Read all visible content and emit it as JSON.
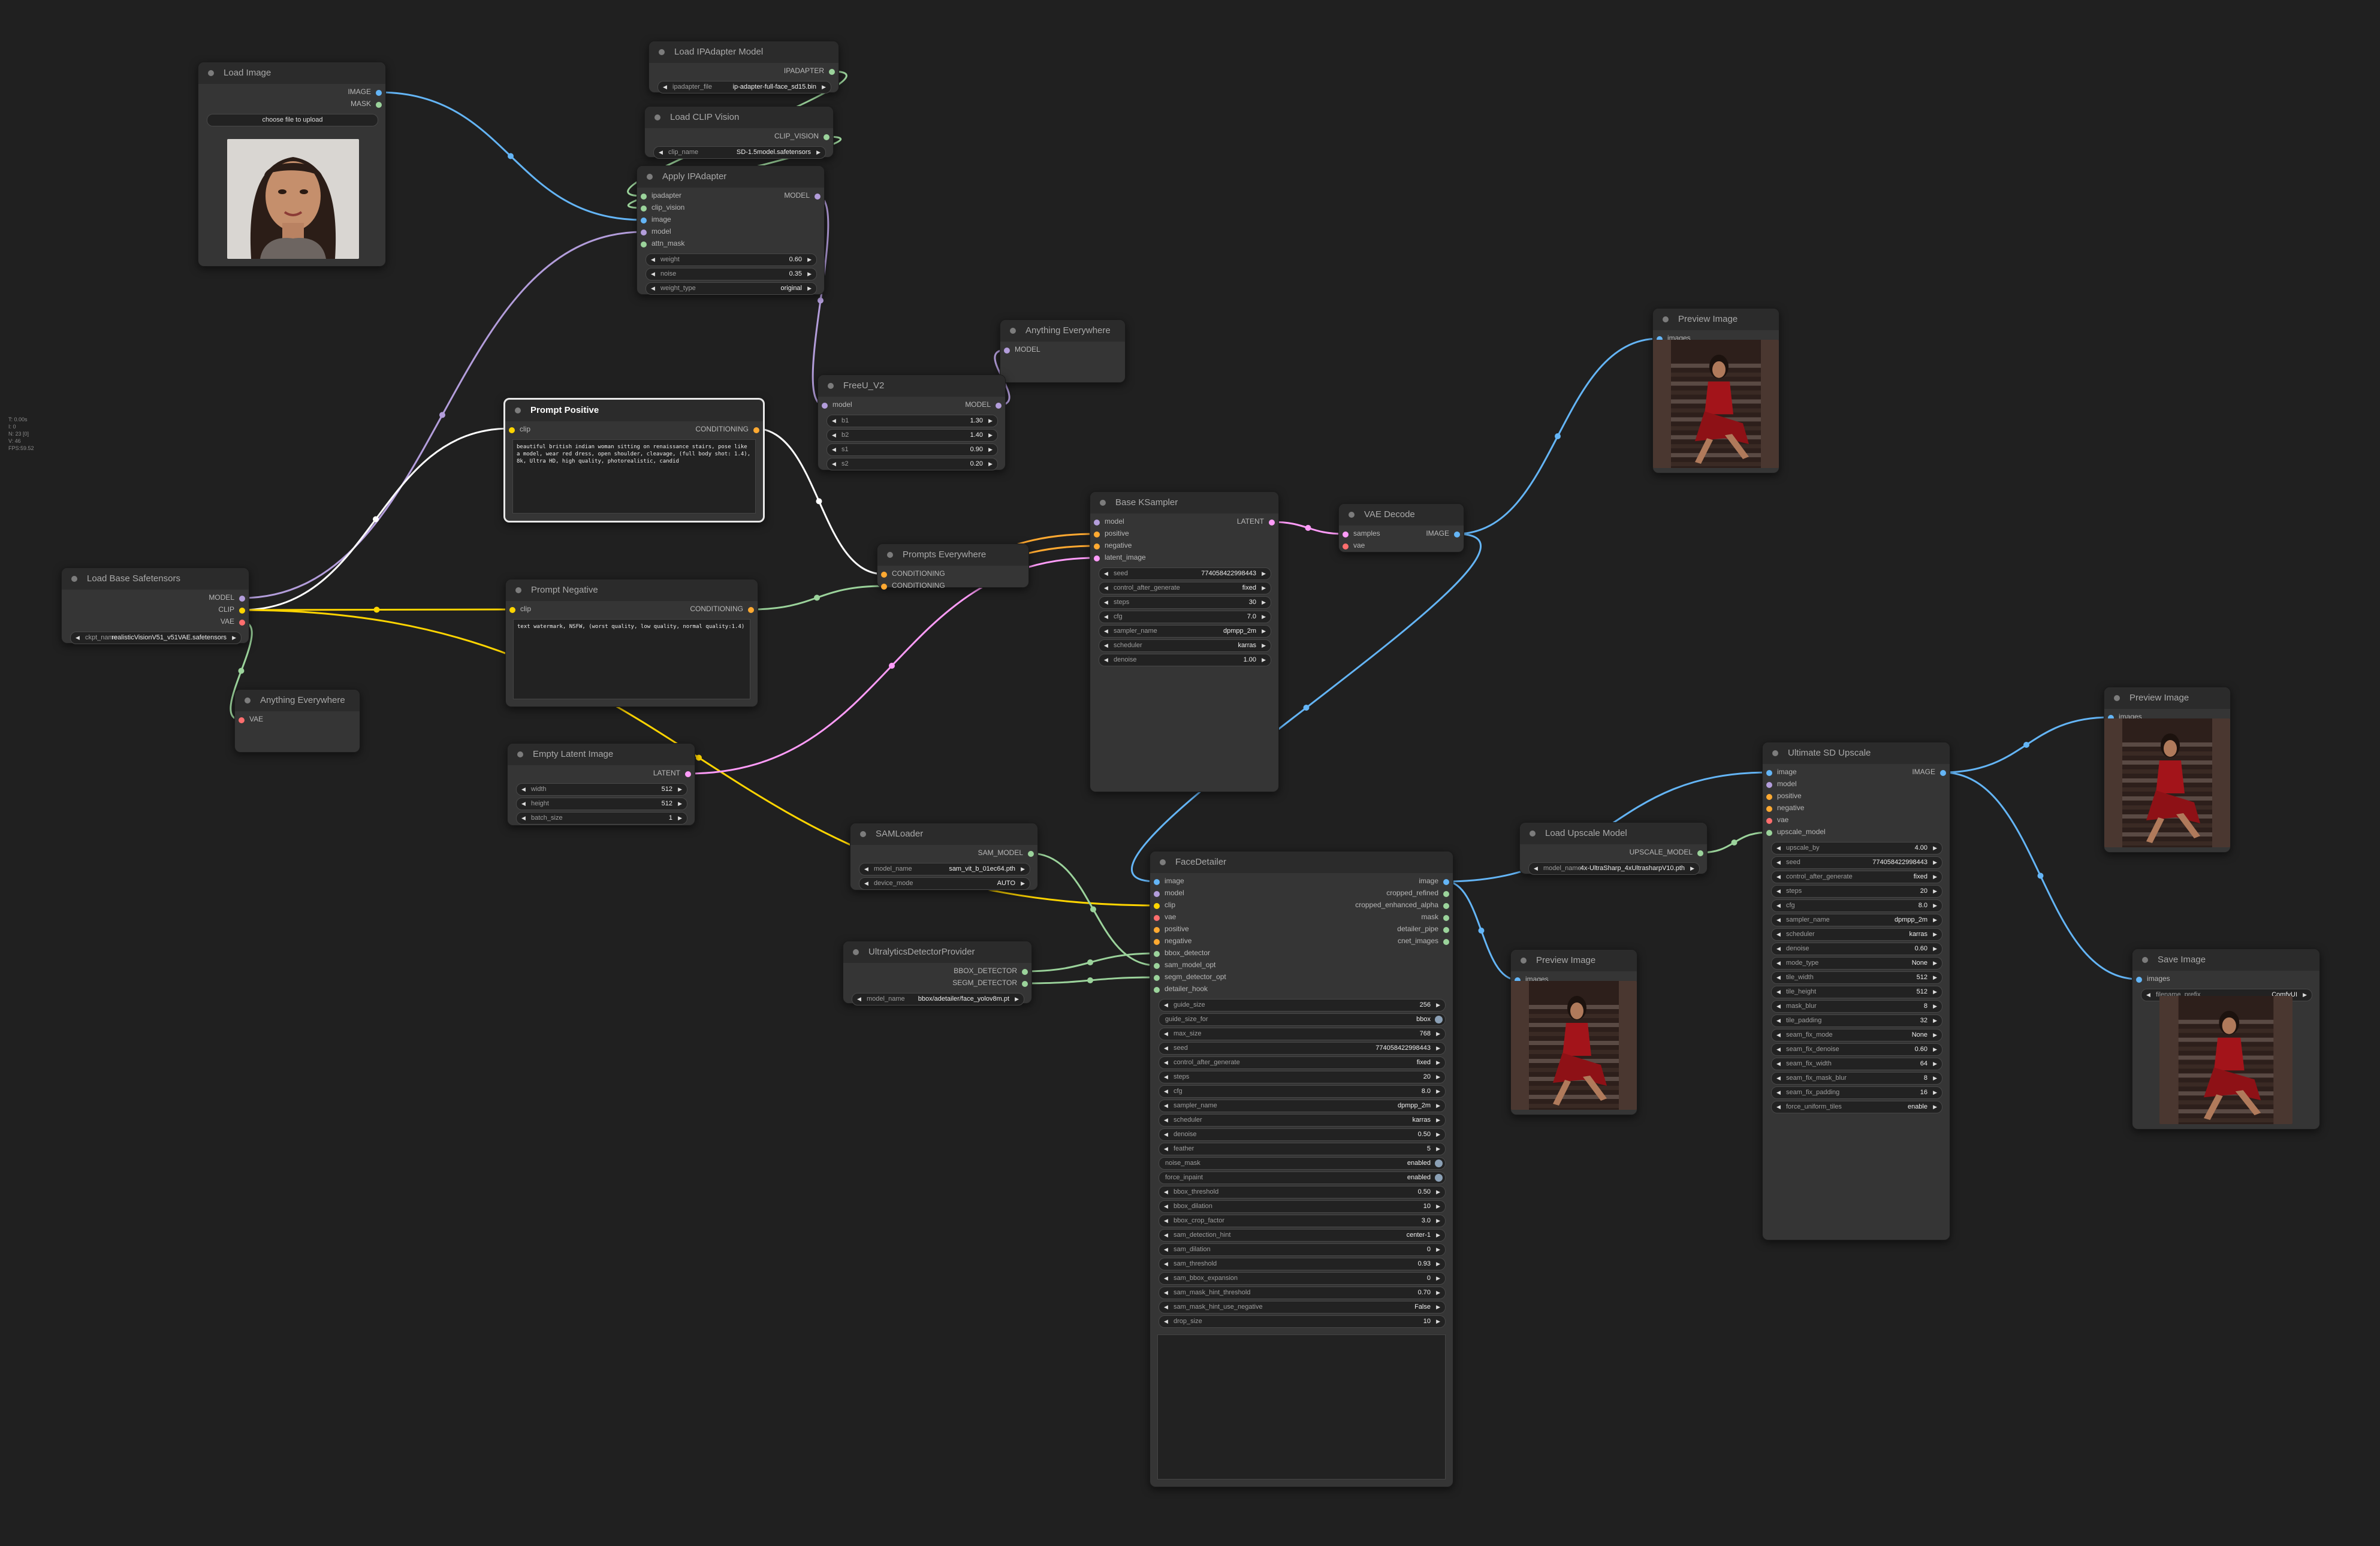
{
  "stats": [
    "T: 0.00s",
    "I: 0",
    "N: 23 [0]",
    "V: 46",
    "FPS:59.52"
  ],
  "nodes": {
    "load_image": {
      "title": "Load Image",
      "outputs": [
        "IMAGE",
        "MASK"
      ],
      "image_value": "C1294920-E295-42EE-97FA-9510BE3BE5A3.jpeg",
      "upload_label": "choose file to upload"
    },
    "load_ipadapter": {
      "title": "Load IPAdapter Model",
      "outputs": [
        "IPADAPTER"
      ],
      "w_label": "ipadapter_file",
      "w_value": "ip-adapter-full-face_sd15.bin"
    },
    "load_clip_vision": {
      "title": "Load CLIP Vision",
      "outputs": [
        "CLIP_VISION"
      ],
      "w_label": "clip_name",
      "w_value": "SD-1.5model.safetensors"
    },
    "apply_ipadapter": {
      "title": "Apply IPAdapter",
      "inputs": [
        "ipadapter",
        "clip_vision",
        "image",
        "model",
        "attn_mask"
      ],
      "outputs": [
        "MODEL"
      ],
      "widgets": [
        {
          "label": "weight",
          "value": "0.60"
        },
        {
          "label": "noise",
          "value": "0.35"
        },
        {
          "label": "weight_type",
          "value": "original"
        }
      ]
    },
    "anything_model": {
      "title": "Anything Everywhere",
      "inputs": [
        "MODEL"
      ]
    },
    "freeu": {
      "title": "FreeU_V2",
      "inputs": [
        "model"
      ],
      "outputs": [
        "MODEL"
      ],
      "widgets": [
        {
          "label": "b1",
          "value": "1.30"
        },
        {
          "label": "b2",
          "value": "1.40"
        },
        {
          "label": "s1",
          "value": "0.90"
        },
        {
          "label": "s2",
          "value": "0.20"
        }
      ]
    },
    "prompt_positive": {
      "title": "Prompt Positive",
      "inputs": [
        "clip"
      ],
      "outputs": [
        "CONDITIONING"
      ],
      "text": "beautiful british indian woman sitting on renaissance stairs, pose like a model, wear red dress, open shoulder, cleavage, (full body shot: 1.4), 8k, Ultra HD, high quality, photorealistic, candid"
    },
    "prompt_negative": {
      "title": "Prompt Negative",
      "inputs": [
        "clip"
      ],
      "outputs": [
        "CONDITIONING"
      ],
      "text": "text watermark, NSFW, (worst quality, low quality, normal quality:1.4)"
    },
    "load_base": {
      "title": "Load Base Safetensors",
      "outputs": [
        "MODEL",
        "CLIP",
        "VAE"
      ],
      "w_label": "ckpt_name",
      "w_value": "realisticVisionV51_v51VAE.safetensors"
    },
    "anything_vae": {
      "title": "Anything Everywhere",
      "inputs": [
        "VAE"
      ]
    },
    "prompts_everywhere": {
      "title": "Prompts Everywhere",
      "inputs": [
        "CONDITIONING",
        "CONDITIONING"
      ]
    },
    "empty_latent": {
      "title": "Empty Latent Image",
      "outputs": [
        "LATENT"
      ],
      "widgets": [
        {
          "label": "width",
          "value": "512"
        },
        {
          "label": "height",
          "value": "512"
        },
        {
          "label": "batch_size",
          "value": "1"
        }
      ]
    },
    "base_ksampler": {
      "title": "Base KSampler",
      "inputs": [
        "model",
        "positive",
        "negative",
        "latent_image"
      ],
      "outputs": [
        "LATENT"
      ],
      "widgets": [
        {
          "label": "seed",
          "value": "774058422998443"
        },
        {
          "label": "control_after_generate",
          "value": "fixed"
        },
        {
          "label": "steps",
          "value": "30"
        },
        {
          "label": "cfg",
          "value": "7.0"
        },
        {
          "label": "sampler_name",
          "value": "dpmpp_2m"
        },
        {
          "label": "scheduler",
          "value": "karras"
        },
        {
          "label": "denoise",
          "value": "1.00"
        }
      ]
    },
    "vae_decode": {
      "title": "VAE Decode",
      "inputs": [
        "samples",
        "vae"
      ],
      "outputs": [
        "IMAGE"
      ]
    },
    "preview1": {
      "title": "Preview Image",
      "inputs": [
        "images"
      ]
    },
    "samloader": {
      "title": "SAMLoader",
      "outputs": [
        "SAM_MODEL"
      ],
      "widgets": [
        {
          "label": "model_name",
          "value": "sam_vit_b_01ec64.pth"
        },
        {
          "label": "device_mode",
          "value": "AUTO"
        }
      ]
    },
    "ultralytics": {
      "title": "UltralyticsDetectorProvider",
      "outputs": [
        "BBOX_DETECTOR",
        "SEGM_DETECTOR"
      ],
      "w_label": "model_name",
      "w_value": "bbox/adetailer/face_yolov8m.pt"
    },
    "facedetailer": {
      "title": "FaceDetailer",
      "inputs": [
        "image",
        "model",
        "clip",
        "vae",
        "positive",
        "negative",
        "bbox_detector",
        "sam_model_opt",
        "segm_detector_opt",
        "detailer_hook"
      ],
      "outputs": [
        "image",
        "cropped_refined",
        "cropped_enhanced_alpha",
        "mask",
        "detailer_pipe",
        "cnet_images"
      ],
      "widgets": [
        {
          "label": "guide_size",
          "value": "256"
        },
        {
          "label": "guide_size_for",
          "value": "bbox",
          "toggle": true
        },
        {
          "label": "max_size",
          "value": "768"
        },
        {
          "label": "seed",
          "value": "774058422998443"
        },
        {
          "label": "control_after_generate",
          "value": "fixed"
        },
        {
          "label": "steps",
          "value": "20"
        },
        {
          "label": "cfg",
          "value": "8.0"
        },
        {
          "label": "sampler_name",
          "value": "dpmpp_2m"
        },
        {
          "label": "scheduler",
          "value": "karras"
        },
        {
          "label": "denoise",
          "value": "0.50"
        },
        {
          "label": "feather",
          "value": "5"
        },
        {
          "label": "noise_mask",
          "value": "enabled",
          "toggle": true
        },
        {
          "label": "force_inpaint",
          "value": "enabled",
          "toggle": true
        },
        {
          "label": "bbox_threshold",
          "value": "0.50"
        },
        {
          "label": "bbox_dilation",
          "value": "10"
        },
        {
          "label": "bbox_crop_factor",
          "value": "3.0"
        },
        {
          "label": "sam_detection_hint",
          "value": "center-1"
        },
        {
          "label": "sam_dilation",
          "value": "0"
        },
        {
          "label": "sam_threshold",
          "value": "0.93"
        },
        {
          "label": "sam_bbox_expansion",
          "value": "0"
        },
        {
          "label": "sam_mask_hint_threshold",
          "value": "0.70"
        },
        {
          "label": "sam_mask_hint_use_negative",
          "value": "False"
        },
        {
          "label": "drop_size",
          "value": "10"
        }
      ]
    },
    "preview2": {
      "title": "Preview Image",
      "inputs": [
        "images"
      ]
    },
    "load_upscale": {
      "title": "Load Upscale Model",
      "outputs": [
        "UPSCALE_MODEL"
      ],
      "w_label": "model_name",
      "w_value": "4x-UltraSharp_4xUltrasharpV10.pth"
    },
    "ultimate_sd": {
      "title": "Ultimate SD Upscale",
      "inputs": [
        "image",
        "model",
        "positive",
        "negative",
        "vae",
        "upscale_model"
      ],
      "outputs": [
        "IMAGE"
      ],
      "widgets": [
        {
          "label": "upscale_by",
          "value": "4.00"
        },
        {
          "label": "seed",
          "value": "774058422998443"
        },
        {
          "label": "control_after_generate",
          "value": "fixed"
        },
        {
          "label": "steps",
          "value": "20"
        },
        {
          "label": "cfg",
          "value": "8.0"
        },
        {
          "label": "sampler_name",
          "value": "dpmpp_2m"
        },
        {
          "label": "scheduler",
          "value": "karras"
        },
        {
          "label": "denoise",
          "value": "0.60"
        },
        {
          "label": "mode_type",
          "value": "None"
        },
        {
          "label": "tile_width",
          "value": "512"
        },
        {
          "label": "tile_height",
          "value": "512"
        },
        {
          "label": "mask_blur",
          "value": "8"
        },
        {
          "label": "tile_padding",
          "value": "32"
        },
        {
          "label": "seam_fix_mode",
          "value": "None"
        },
        {
          "label": "seam_fix_denoise",
          "value": "0.60"
        },
        {
          "label": "seam_fix_width",
          "value": "64"
        },
        {
          "label": "seam_fix_mask_blur",
          "value": "8"
        },
        {
          "label": "seam_fix_padding",
          "value": "16"
        },
        {
          "label": "force_uniform_tiles",
          "value": "enable"
        }
      ]
    },
    "preview3": {
      "title": "Preview Image",
      "inputs": [
        "images"
      ]
    },
    "save_image": {
      "title": "Save Image",
      "inputs": [
        "images"
      ],
      "w_label": "filename_prefix",
      "w_value": "ComfyUI"
    }
  },
  "colors": {
    "image": "#64b5f6",
    "model": "#b39ddb",
    "clip": "#ffd500",
    "vae": "#ff6e6e",
    "conditioning": "#ffa931",
    "latent": "#ff9cf9",
    "other": "#9bd39b",
    "canvas": "#202020",
    "node": "#353535"
  }
}
